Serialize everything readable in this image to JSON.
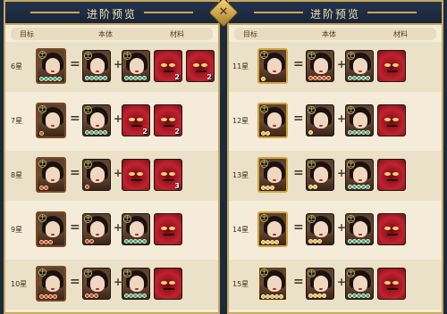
{
  "left_panel": {
    "title": "进阶预览",
    "headers": {
      "target": "目标",
      "base": "本体",
      "material": "材料"
    },
    "rows": [
      {
        "star_label": "6星",
        "target_badge": "主",
        "target_pips": 5,
        "target_pip_color": "green",
        "base_badge": "主",
        "base_pips": 5,
        "base_pip_color": "green",
        "materials": [
          {
            "kind": "portrait",
            "badge": "主",
            "pips": 5,
            "count": ""
          },
          {
            "kind": "demon",
            "count": "2"
          },
          {
            "kind": "demon",
            "count": "2"
          }
        ]
      },
      {
        "star_label": "7星",
        "target_badge": "主",
        "target_pips": 1,
        "target_pip_color": "red",
        "base_badge": "主",
        "base_pips": 5,
        "base_pip_color": "green",
        "materials": [
          {
            "kind": "demon",
            "count": "2"
          },
          {
            "kind": "demon",
            "count": "2"
          }
        ]
      },
      {
        "star_label": "8星",
        "target_badge": "主",
        "target_pips": 2,
        "target_pip_color": "red",
        "base_badge": "主",
        "base_pips": 1,
        "base_pip_color": "red",
        "materials": [
          {
            "kind": "demon",
            "count": ""
          },
          {
            "kind": "demon",
            "count": "3"
          }
        ]
      },
      {
        "star_label": "9星",
        "target_badge": "主",
        "target_pips": 3,
        "target_pip_color": "red",
        "base_badge": "主",
        "base_pips": 2,
        "base_pip_color": "red",
        "materials": [
          {
            "kind": "portrait",
            "badge": "主",
            "pips": 5,
            "count": ""
          },
          {
            "kind": "demon",
            "count": ""
          }
        ]
      },
      {
        "star_label": "10星",
        "target_badge": "主",
        "target_pips": 4,
        "target_pip_color": "red",
        "base_badge": "主",
        "base_pips": 3,
        "base_pip_color": "red",
        "materials": [
          {
            "kind": "portrait",
            "badge": "主",
            "pips": 5,
            "count": ""
          },
          {
            "kind": "demon",
            "count": ""
          }
        ]
      }
    ]
  },
  "right_panel": {
    "title": "进阶预览",
    "headers": {
      "target": "目标",
      "base": "本体",
      "material": "材料"
    },
    "rows": [
      {
        "star_label": "11星",
        "target_badge": "主",
        "target_pips": 1,
        "target_pip_color": "gold",
        "base_badge": "主",
        "base_pips": 5,
        "base_pip_color": "red",
        "materials": [
          {
            "kind": "portrait",
            "badge": "主",
            "pips": 5,
            "count": ""
          },
          {
            "kind": "demon",
            "count": ""
          }
        ]
      },
      {
        "star_label": "12星",
        "target_badge": "主",
        "target_pips": 2,
        "target_pip_color": "gold",
        "base_badge": "主",
        "base_pips": 1,
        "base_pip_color": "gold",
        "materials": [
          {
            "kind": "portrait",
            "badge": "主",
            "pips": 5,
            "count": ""
          },
          {
            "kind": "demon",
            "count": ""
          }
        ]
      },
      {
        "star_label": "13星",
        "target_badge": "主",
        "target_pips": 3,
        "target_pip_color": "gold",
        "base_badge": "主",
        "base_pips": 2,
        "base_pip_color": "gold",
        "materials": [
          {
            "kind": "portrait",
            "badge": "主",
            "pips": 5,
            "count": ""
          },
          {
            "kind": "demon",
            "count": ""
          }
        ]
      },
      {
        "star_label": "14星",
        "target_badge": "主",
        "target_pips": 4,
        "target_pip_color": "gold",
        "base_badge": "主",
        "base_pips": 3,
        "base_pip_color": "gold",
        "materials": [
          {
            "kind": "portrait",
            "badge": "主",
            "pips": 5,
            "count": ""
          },
          {
            "kind": "demon",
            "count": ""
          }
        ]
      },
      {
        "star_label": "15星",
        "target_badge": "主",
        "target_pips": 5,
        "target_pip_color": "gold",
        "base_badge": "主",
        "base_pips": 4,
        "base_pip_color": "gold",
        "materials": [
          {
            "kind": "portrait",
            "badge": "主",
            "pips": 5,
            "count": ""
          },
          {
            "kind": "demon",
            "count": ""
          }
        ]
      }
    ]
  },
  "close_icon": "✕",
  "colors": {
    "panel_bg": "#f4ecd8",
    "title_bar": "#24344e",
    "gold_border": "#c9a85a",
    "demon_red": "#c02230",
    "pip_green": "#2fae6e",
    "pip_red": "#d13a2a",
    "pip_gold": "#e7b84a"
  }
}
